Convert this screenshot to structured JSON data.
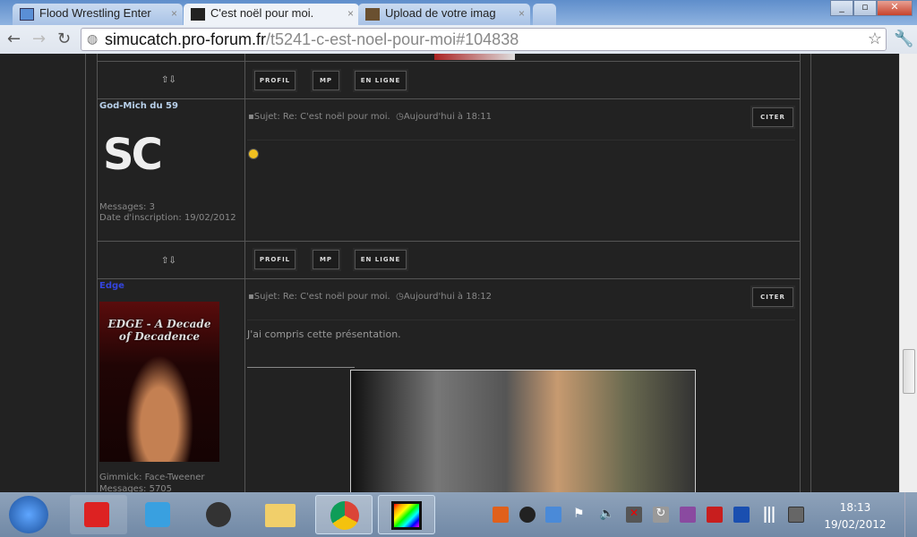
{
  "browser": {
    "tabs": [
      {
        "label": "Flood Wrestling Enter",
        "icon": "monitor-icon"
      },
      {
        "label": "C'est noël pour moi.",
        "icon": "wwe-icon",
        "active": true
      },
      {
        "label": "Upload de votre imag",
        "icon": "camera-icon"
      }
    ],
    "url_host": "simucatch.pro-forum.fr",
    "url_path": "/t5241-c-est-noel-pour-moi#104838"
  },
  "post_buttons": {
    "profile": "PROFIL",
    "pm": "MP",
    "online": "EN LIGNE",
    "quote": "CITER"
  },
  "posts": [
    {
      "author": "God-Mich du 59",
      "author_color": "#b8d0ea",
      "avatar_text": "SC",
      "subject": "Sujet: Re: C'est noël pour moi.",
      "time": "Aujourd'hui à 18:11",
      "body": "",
      "emoticon": "laughing-smiley",
      "stats": [
        "Messages: 3",
        "Date d'inscription: 19/02/2012"
      ]
    },
    {
      "author": "Edge",
      "author_color": "#3344dd",
      "avatar_text": "EDGE - A Decade of Decadence",
      "subject": "Sujet: Re: C'est noël pour moi.",
      "time": "Aujourd'hui à 18:12",
      "body": "J'ai compris cette présentation.",
      "stats": [
        "Gimmick: Face-Tweener",
        "Messages: 5705"
      ]
    }
  ],
  "taskbar": {
    "time": "18:13",
    "date": "19/02/2012"
  }
}
